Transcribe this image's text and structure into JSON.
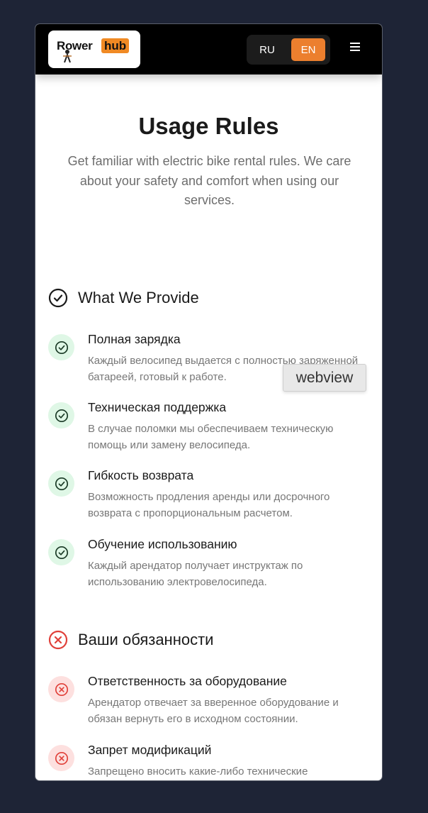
{
  "header": {
    "logo_word_left": "Rower",
    "logo_word_right": "hub",
    "lang_options": [
      "RU",
      "EN"
    ],
    "active_lang": "EN",
    "menu_icon": "hamburger-icon",
    "colors": {
      "bar": "#000000",
      "accent": "#ec7f2e"
    }
  },
  "hero": {
    "title": "Usage Rules",
    "subtitle": "Get familiar with electric bike rental rules. We care about your safety and comfort when using our services."
  },
  "provide": {
    "title": "What We Provide",
    "icon": "check-circle-icon",
    "items": [
      {
        "title": "Полная зарядка",
        "desc": "Каждый велосипед выдается с полностью заряженной батареей, готовый к работе."
      },
      {
        "title": "Техническая поддержка",
        "desc": "В случае поломки мы обеспечиваем техническую помощь или замену велосипеда."
      },
      {
        "title": "Гибкость возврата",
        "desc": "Возможность продления аренды или досрочного возврата с пропорциональным расчетом."
      },
      {
        "title": "Обучение использованию",
        "desc": "Каждый арендатор получает инструктаж по использованию электровелосипеда."
      }
    ]
  },
  "obligations": {
    "title": "Ваши обязанности",
    "icon": "x-circle-icon",
    "items": [
      {
        "title": "Ответственность за оборудование",
        "desc": "Арендатор отвечает за вверенное оборудование и обязан вернуть его в исходном состоянии."
      },
      {
        "title": "Запрет модификаций",
        "desc": "Запрещено вносить какие-либо технические модификации в велосипед."
      }
    ]
  },
  "tooltip": {
    "label": "webview"
  },
  "colors": {
    "ok": "#1c6b3a",
    "ok_bg": "#dff7e6",
    "bad": "#e0413a",
    "bad_bg": "#fde0df"
  }
}
